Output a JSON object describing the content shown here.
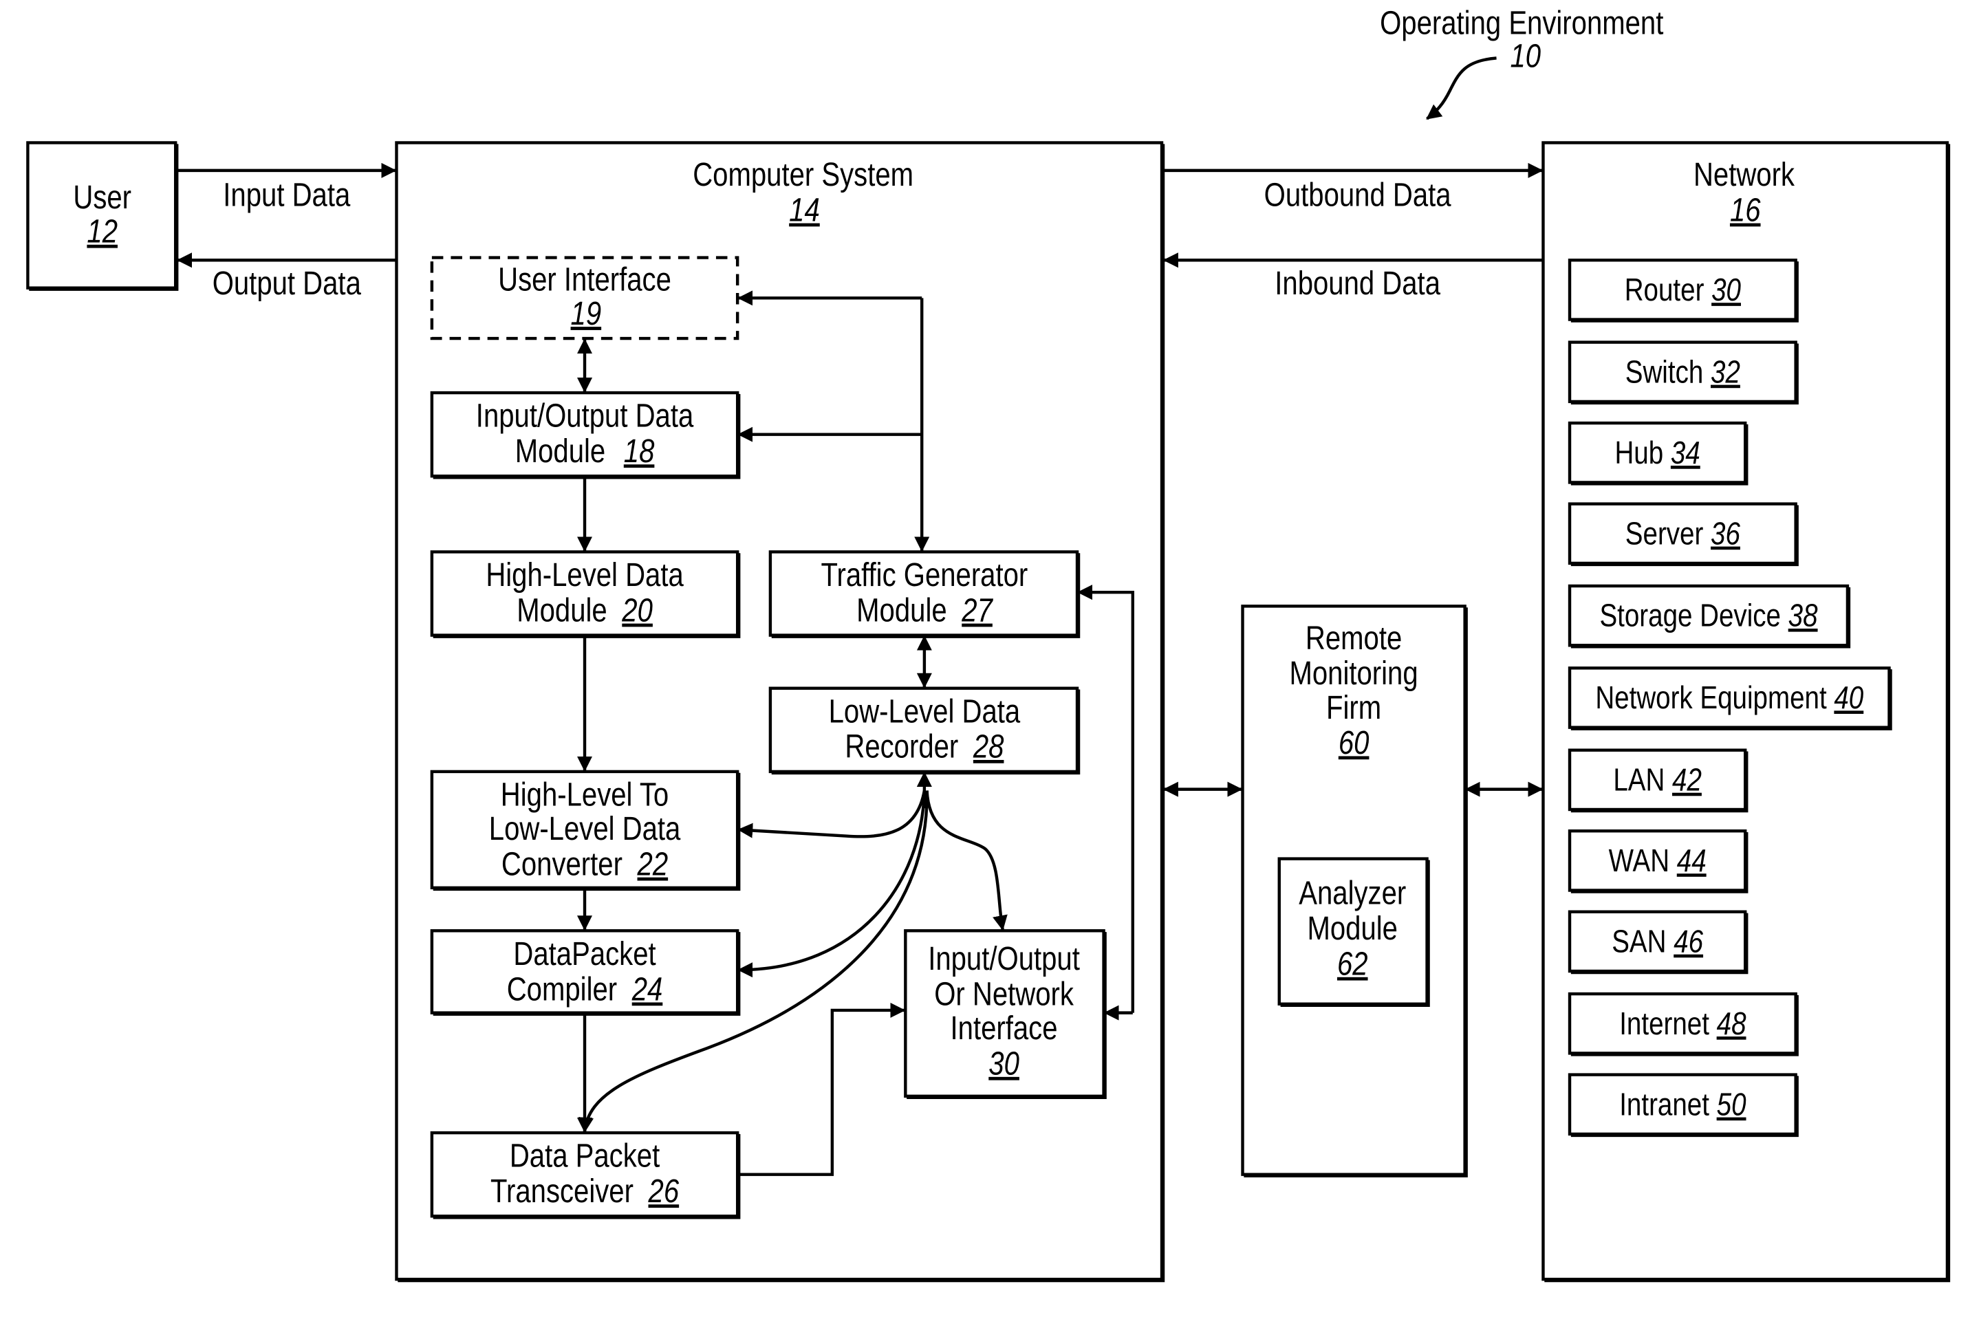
{
  "figure": {
    "title": "Operating Environment",
    "reference": "10"
  },
  "user": {
    "label": "User",
    "ref": "12"
  },
  "links": {
    "input_data": "Input Data",
    "output_data": "Output Data",
    "outbound_data": "Outbound Data",
    "inbound_data": "Inbound Data"
  },
  "computer_system": {
    "label": "Computer System",
    "ref": "14",
    "modules": {
      "user_interface": {
        "lines": [
          "User Interface"
        ],
        "ref": "19"
      },
      "io_data_module": {
        "lines": [
          "Input/Output Data",
          "Module"
        ],
        "ref": "18"
      },
      "high_level_data_module": {
        "lines": [
          "High-Level Data",
          "Module"
        ],
        "ref": "20"
      },
      "converter": {
        "lines": [
          "High-Level To",
          "Low-Level Data",
          "Converter"
        ],
        "ref": "22"
      },
      "compiler": {
        "lines": [
          "DataPacket",
          "Compiler"
        ],
        "ref": "24"
      },
      "transceiver": {
        "lines": [
          "Data Packet",
          "Transceiver"
        ],
        "ref": "26"
      },
      "traffic_generator": {
        "lines": [
          "Traffic Generator",
          "Module"
        ],
        "ref": "27"
      },
      "recorder": {
        "lines": [
          "Low-Level Data",
          "Recorder"
        ],
        "ref": "28"
      },
      "network_interface": {
        "lines": [
          "Input/Output",
          "Or Network",
          "Interface"
        ],
        "ref": "30"
      }
    }
  },
  "remote_monitoring": {
    "lines": [
      "Remote",
      "Monitoring",
      "Firm"
    ],
    "ref": "60",
    "analyzer": {
      "lines": [
        "Analyzer",
        "Module"
      ],
      "ref": "62"
    }
  },
  "network": {
    "label": "Network",
    "ref": "16",
    "items": [
      {
        "label": "Router",
        "ref": "30"
      },
      {
        "label": "Switch",
        "ref": "32"
      },
      {
        "label": "Hub",
        "ref": "34"
      },
      {
        "label": "Server",
        "ref": "36"
      },
      {
        "label": "Storage Device",
        "ref": "38"
      },
      {
        "label": "Network Equipment",
        "ref": "40"
      },
      {
        "label": "LAN",
        "ref": "42"
      },
      {
        "label": "WAN",
        "ref": "44"
      },
      {
        "label": "SAN",
        "ref": "46"
      },
      {
        "label": "Internet",
        "ref": "48"
      },
      {
        "label": "Intranet",
        "ref": "50"
      }
    ]
  }
}
